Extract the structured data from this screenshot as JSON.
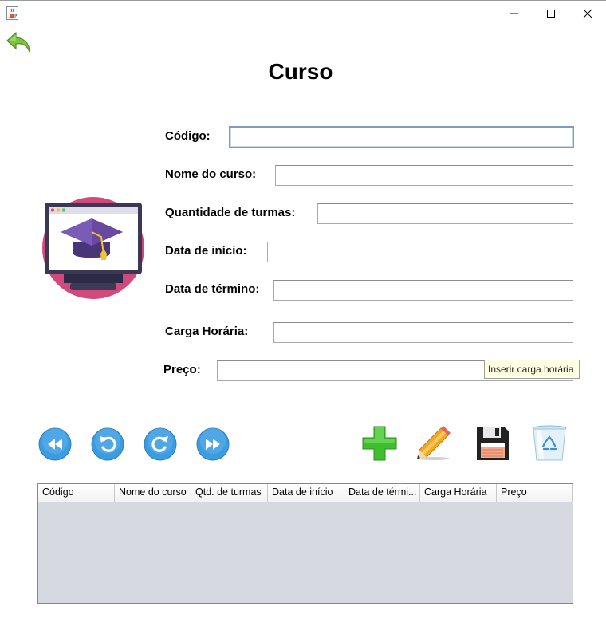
{
  "window": {
    "icon": "java-cup-icon",
    "controls": [
      "minimize-icon",
      "maximize-icon",
      "close-icon"
    ]
  },
  "toolbar": {
    "back_icon": "back-arrow-icon"
  },
  "page": {
    "title": "Curso"
  },
  "form": {
    "codigo_label": "Código:",
    "codigo_value": "",
    "nome_label": "Nome do curso:",
    "nome_value": "",
    "qtd_label": "Quantidade de turmas:",
    "qtd_value": "",
    "inicio_label": "Data de início:",
    "inicio_value": "",
    "termino_label": "Data de término:",
    "termino_value": "",
    "carga_label": "Carga Horária:",
    "carga_value": "",
    "preco_label": "Preço:",
    "preco_value": ""
  },
  "tooltip": {
    "text": "Inserir carga horária"
  },
  "illustration": {
    "icon": "graduation-cap-monitor-icon"
  },
  "navigation": [
    "first-record-icon",
    "previous-record-icon",
    "next-record-icon",
    "last-record-icon"
  ],
  "actions": [
    "add-icon",
    "edit-pencil-icon",
    "save-floppy-icon",
    "delete-recycle-bin-icon"
  ],
  "table": {
    "columns": [
      "Código",
      "Nome do curso",
      "Qtd. de turmas",
      "Data de início",
      "Data de térmi...",
      "Carga Horária",
      "Preço"
    ],
    "rows": []
  },
  "colors": {
    "nav_button": "#3d9be0",
    "add": "#3fbf2f",
    "illustration_circle": "#d24a7c",
    "cap": "#6a4aa0"
  }
}
